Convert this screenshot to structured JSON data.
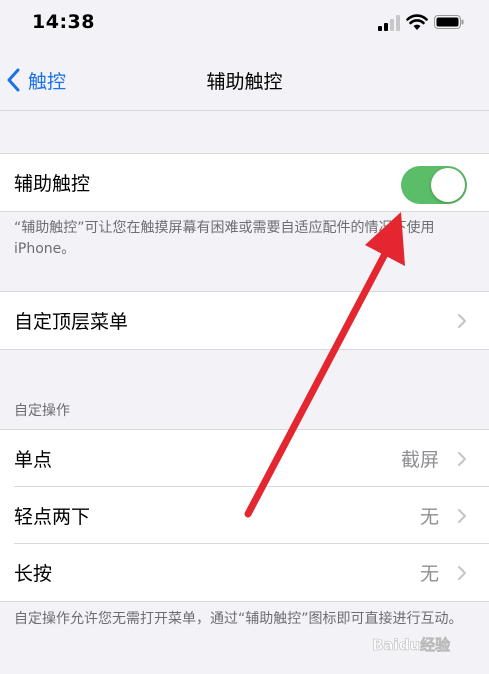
{
  "status_bar": {
    "time": "14:38"
  },
  "nav": {
    "back_label": "触控",
    "title": "辅助触控"
  },
  "assistive_touch": {
    "label": "辅助触控",
    "enabled": true,
    "footnote": "“辅助触控”可让您在触摸屏幕有困难或需要自适应配件的情况下使用iPhone。"
  },
  "top_menu": {
    "label": "自定顶层菜单"
  },
  "custom_actions": {
    "header": "自定操作",
    "rows": [
      {
        "label": "单点",
        "value": "截屏"
      },
      {
        "label": "轻点两下",
        "value": "无"
      },
      {
        "label": "长按",
        "value": "无"
      }
    ],
    "footnote": "自定操作允许您无需打开菜单，通过“辅助触控”图标即可直接进行互动。"
  },
  "colors": {
    "accent": "#1b72e8",
    "toggle_on": "#5cbd68",
    "arrow": "#e3262f"
  },
  "watermark": {
    "text": "Baidu经验"
  }
}
